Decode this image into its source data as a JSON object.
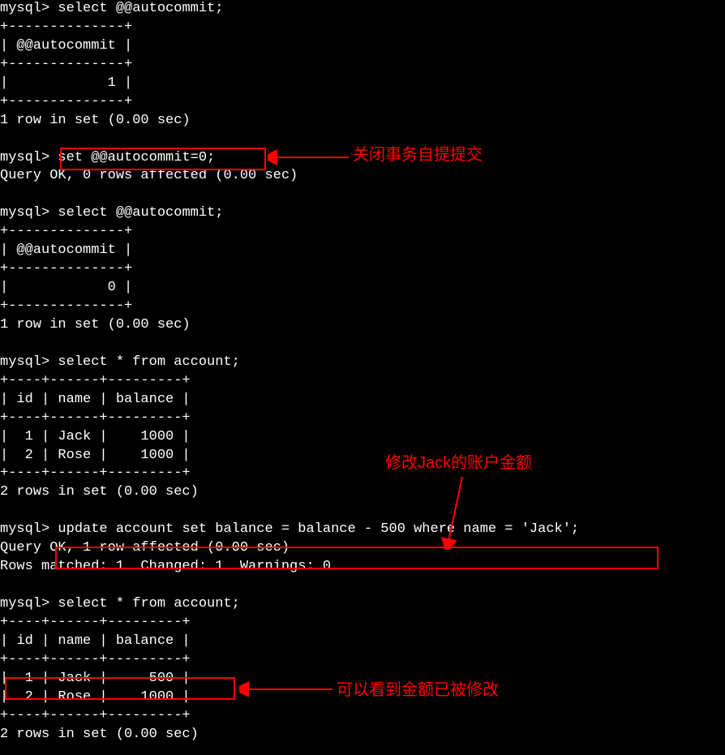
{
  "prompt": "mysql>",
  "queries": {
    "q1": "select @@autocommit;",
    "q2": "set @@autocommit=0;",
    "q3": "select @@autocommit;",
    "q4": "select * from account;",
    "q5": "update account set balance = balance - 500 where name = 'Jack';",
    "q6": "select * from account;"
  },
  "table_autocommit_1": {
    "border_top": "+--------------+",
    "header": "| @@autocommit |",
    "sep": "+--------------+",
    "row": "|            1 |",
    "border_bot": "+--------------+",
    "footer": "1 row in set (0.00 sec)"
  },
  "table_autocommit_2": {
    "border_top": "+--------------+",
    "header": "| @@autocommit |",
    "sep": "+--------------+",
    "row": "|            0 |",
    "border_bot": "+--------------+",
    "footer": "1 row in set (0.00 sec)"
  },
  "query_ok": "Query OK, 0 rows affected (0.00 sec)",
  "table_account_1": {
    "border": "+----+------+---------+",
    "header": "| id | name | balance |",
    "row1": "|  1 | Jack |    1000 |",
    "row2": "|  2 | Rose |    1000 |",
    "footer": "2 rows in set (0.00 sec)"
  },
  "update_result": {
    "line1": "Query OK, 1 row affected (0.00 sec)",
    "line2": "Rows matched: 1  Changed: 1  Warnings: 0"
  },
  "table_account_2": {
    "border": "+----+------+---------+",
    "header": "| id | name | balance |",
    "row1": "|  1 | Jack |     500 |",
    "row2": "|  2 | Rose |    1000 |",
    "footer": "2 rows in set (0.00 sec)"
  },
  "annotations": {
    "a1": "关闭事务自提提交",
    "a2": "修改Jack的账户金额",
    "a3": "可以看到金额已被修改"
  }
}
